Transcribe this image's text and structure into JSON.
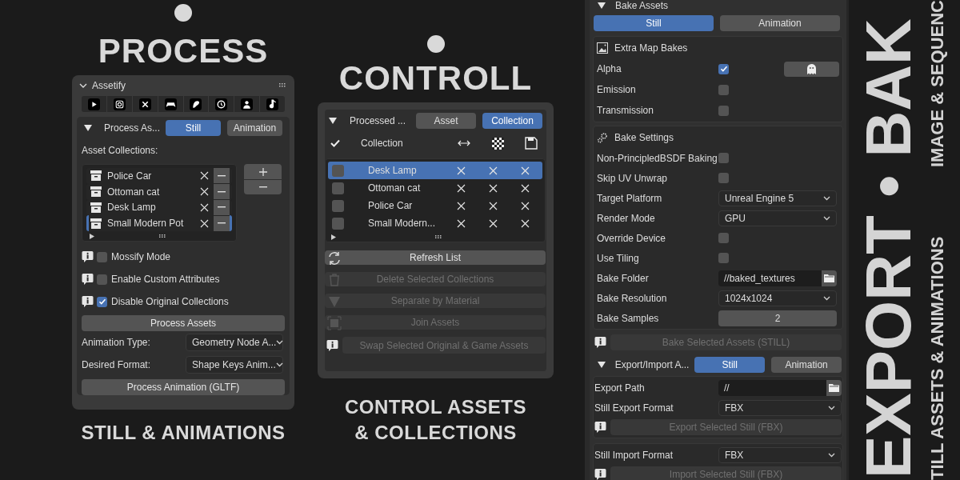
{
  "process": {
    "heading": "PROCESS",
    "caption": "STILL & ANIMATIONS",
    "panel": {
      "title": "Assetify",
      "expanded": true,
      "section": {
        "title": "Process As...",
        "expanded": true,
        "tabs": [
          {
            "label": "Still",
            "selected": true
          },
          {
            "label": "Animation",
            "selected": false
          }
        ]
      },
      "list_label": "Asset Collections:",
      "collections": [
        {
          "name": "Police Car",
          "selected": false
        },
        {
          "name": "Ottoman cat",
          "selected": false
        },
        {
          "name": "Desk Lamp",
          "selected": false
        },
        {
          "name": "Small Modern Pot",
          "selected": true
        }
      ],
      "options": [
        {
          "label": "Mossify Mode",
          "checked": false
        },
        {
          "label": "Enable Custom Attributes",
          "checked": false
        },
        {
          "label": "Disable Original Collections",
          "checked": true
        }
      ],
      "process_button": "Process Assets",
      "dropdowns": [
        {
          "label": "Animation Type:",
          "value": "Geometry Node A..."
        },
        {
          "label": "Desired Format:",
          "value": "Shape Keys Anim..."
        }
      ],
      "animation_button": "Process Animation (GLTF)"
    }
  },
  "control": {
    "heading": "CONTROLL",
    "caption_lines": [
      "CONTROL ASSETS",
      "& COLLECTIONS"
    ],
    "panel": {
      "title": "Processed ...",
      "expanded": true,
      "tabs": [
        {
          "label": "Asset",
          "selected": false
        },
        {
          "label": "Collection",
          "selected": true
        }
      ],
      "column_label": "Collection",
      "rows": [
        {
          "name": "Desk Lamp",
          "selected": true,
          "checked": false
        },
        {
          "name": "Ottoman cat",
          "selected": false,
          "checked": false
        },
        {
          "name": "Police Car",
          "selected": false,
          "checked": false
        },
        {
          "name": "Small Modern...",
          "selected": false,
          "checked": false
        }
      ],
      "actions": [
        {
          "kind": "refresh",
          "label": "Refresh List",
          "disabled": false
        },
        {
          "kind": "delete",
          "label": "Delete Selected Collections",
          "disabled": true
        },
        {
          "kind": "separate",
          "label": "Separate by Material",
          "disabled": true
        },
        {
          "kind": "join",
          "label": "Join Assets",
          "disabled": true
        },
        {
          "kind": "info",
          "label": "Swap Selected Original & Game Assets",
          "disabled": true
        }
      ]
    }
  },
  "bake": {
    "title": "Bake Assets",
    "expanded": true,
    "tabs": [
      {
        "label": "Still",
        "selected": true
      },
      {
        "label": "Animation",
        "selected": false
      }
    ],
    "extra": {
      "title": "Extra Map Bakes",
      "rows": [
        {
          "kind": "checkbox_button",
          "label": "Alpha",
          "checked": true
        },
        {
          "kind": "checkbox",
          "label": "Emission",
          "checked": false
        },
        {
          "kind": "checkbox",
          "label": "Transmission",
          "checked": false
        }
      ]
    },
    "settings": {
      "title": "Bake Settings",
      "rows": [
        {
          "kind": "checkbox",
          "label": "Non-PrincipledBSDF Baking",
          "checked": false
        },
        {
          "kind": "checkbox",
          "label": "Skip UV Unwrap",
          "checked": false
        },
        {
          "kind": "dropdown",
          "label": "Target Platform",
          "value": "Unreal Engine 5"
        },
        {
          "kind": "dropdown",
          "label": "Render Mode",
          "value": "GPU"
        },
        {
          "kind": "checkbox",
          "label": "Override Device",
          "checked": false
        },
        {
          "kind": "checkbox",
          "label": "Use Tiling",
          "checked": false
        },
        {
          "kind": "path",
          "label": "Bake Folder",
          "value": "//baked_textures"
        },
        {
          "kind": "dropdown",
          "label": "Bake Resolution",
          "value": "1024x1024"
        },
        {
          "kind": "number",
          "label": "Bake Samples",
          "value": "2"
        }
      ]
    },
    "bake_button": {
      "label": "Bake Selected Assets (STILL)",
      "disabled": true
    }
  },
  "export": {
    "title": "Export/Import A...",
    "expanded": true,
    "tabs": [
      {
        "label": "Still",
        "selected": true
      },
      {
        "label": "Animation",
        "selected": false
      }
    ],
    "groups": [
      {
        "rows": [
          {
            "kind": "path",
            "label": "Export Path",
            "value": "//"
          },
          {
            "kind": "dropdown",
            "label": "Still Export Format",
            "value": "FBX"
          }
        ],
        "button": {
          "label": "Export Selected Still (FBX)",
          "disabled": true
        }
      },
      {
        "rows": [
          {
            "kind": "dropdown",
            "label": "Still Import Format",
            "value": "FBX"
          }
        ],
        "button": {
          "label": "Import Selected Still (FBX)",
          "disabled": true
        }
      }
    ]
  },
  "banner": {
    "title": "EXPORT • BAK",
    "lines": [
      "TILL ASSETS & ANIMATIONS",
      "IMAGE & SEQUENC"
    ]
  }
}
